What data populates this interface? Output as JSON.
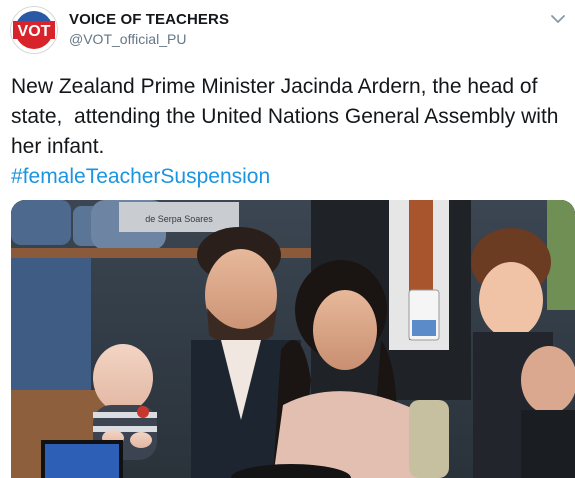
{
  "tweet": {
    "display_name": "VOICE OF TEACHERS",
    "handle": "@VOT_official_PU",
    "text": "New Zealand Prime Minister Jacinda Ardern, the head of state,  attending the United Nations General Assembly with her infant.",
    "hashtag": "#femaleTeacherSuspension"
  },
  "avatar": {
    "logo_text": "VOT"
  },
  "photo": {
    "nameplate_text": "de Serpa Soares"
  },
  "colors": {
    "hashtag": "#1b95e0",
    "handle": "#657786",
    "logo_red": "#d8232a",
    "logo_blue": "#2a5aa6"
  },
  "icons": {
    "menu": "chevron-down-icon"
  }
}
